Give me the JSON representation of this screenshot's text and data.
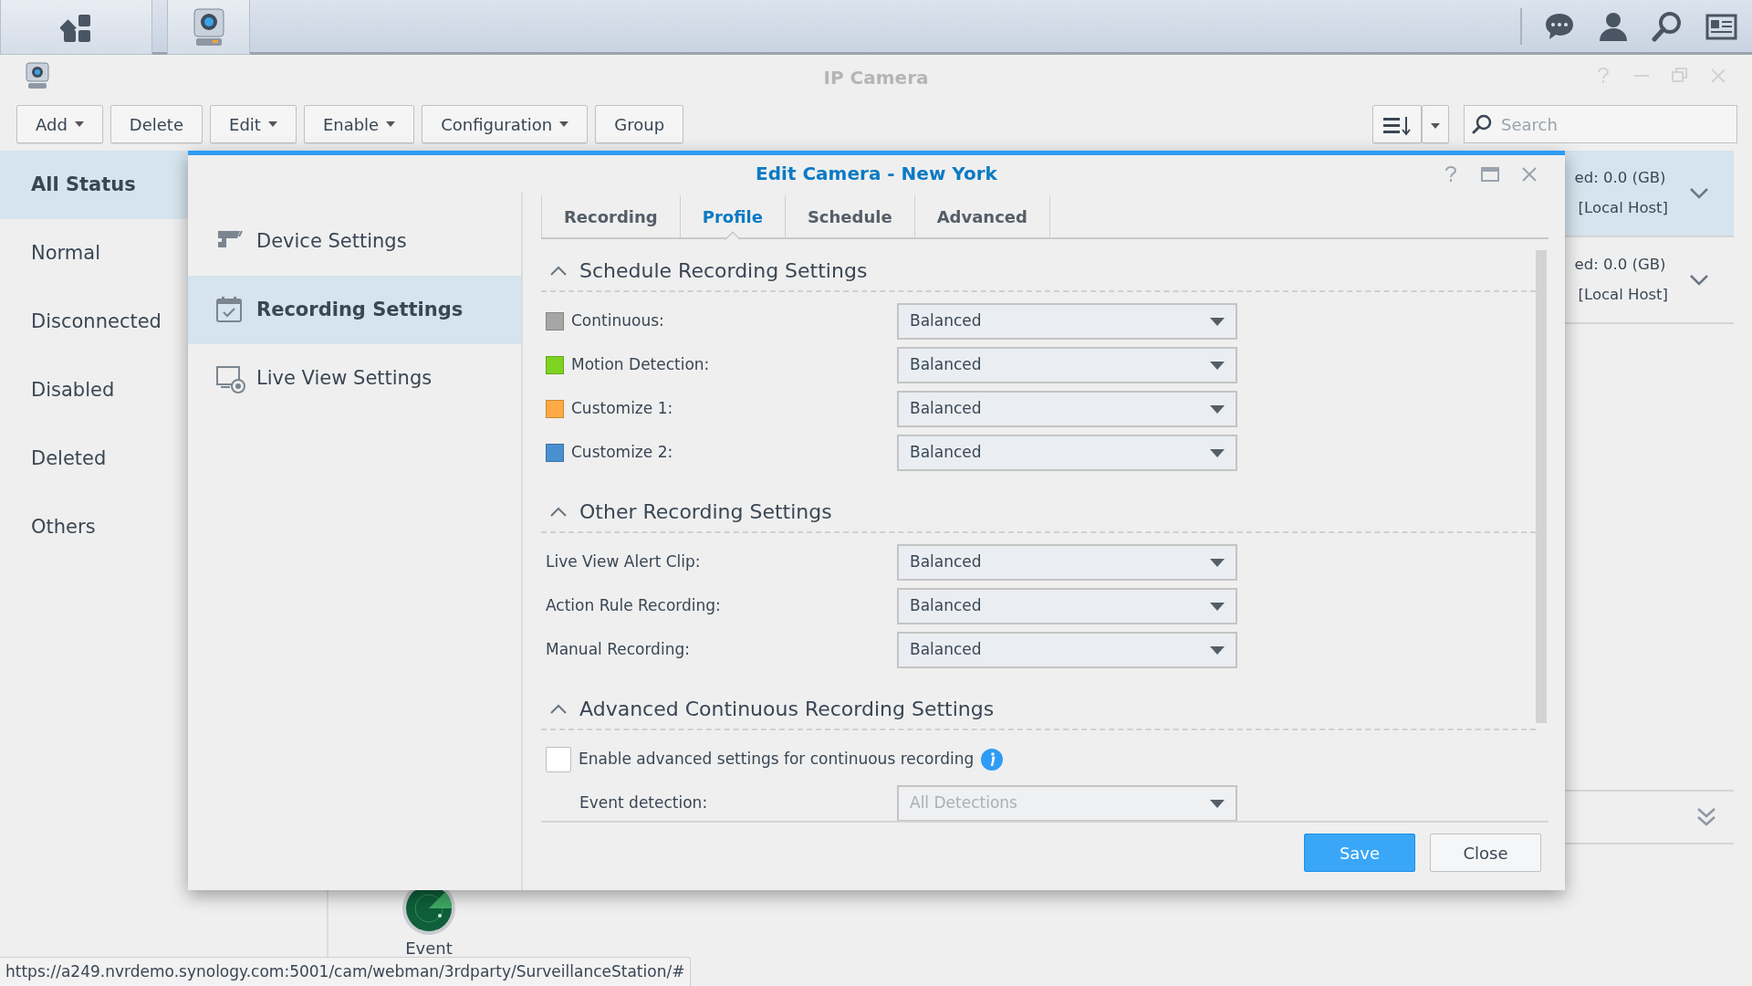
{
  "window": {
    "title": "IP Camera"
  },
  "toolbar": {
    "buttons": [
      {
        "label": "Add",
        "dropdown": true
      },
      {
        "label": "Delete",
        "dropdown": false
      },
      {
        "label": "Edit",
        "dropdown": true
      },
      {
        "label": "Enable",
        "dropdown": true
      },
      {
        "label": "Configuration",
        "dropdown": true
      },
      {
        "label": "Group",
        "dropdown": false
      }
    ],
    "search": {
      "placeholder": "Search"
    }
  },
  "sidebar": {
    "items": [
      {
        "label": "All Status",
        "selected": true
      },
      {
        "label": "Normal",
        "selected": false
      },
      {
        "label": "Disconnected",
        "selected": false
      },
      {
        "label": "Disabled",
        "selected": false
      },
      {
        "label": "Deleted",
        "selected": false
      },
      {
        "label": "Others",
        "selected": false
      }
    ]
  },
  "camera_list": {
    "rows": [
      {
        "storage": "ed: 0.0 (GB)",
        "host": "[Local Host]",
        "selected": true
      },
      {
        "storage": "ed: 0.0 (GB)",
        "host": "[Local Host]",
        "selected": false
      }
    ]
  },
  "app_icons": [
    {
      "label": "Event"
    }
  ],
  "dialog": {
    "title": "Edit Camera - New York",
    "nav": [
      {
        "label": "Device Settings",
        "kind": "device",
        "selected": false
      },
      {
        "label": "Recording Settings",
        "kind": "recording",
        "selected": true
      },
      {
        "label": "Live View Settings",
        "kind": "liveview",
        "selected": false
      }
    ],
    "tabs": [
      {
        "label": "Recording",
        "selected": false
      },
      {
        "label": "Profile",
        "selected": true
      },
      {
        "label": "Schedule",
        "selected": false
      },
      {
        "label": "Advanced",
        "selected": false
      }
    ],
    "sections": [
      {
        "title": "Schedule Recording Settings",
        "expanded": true,
        "rows": [
          {
            "kind": "select",
            "label": "Continuous:",
            "color": "#a6a6a6",
            "value": "Balanced",
            "disabled": false
          },
          {
            "kind": "select",
            "label": "Motion Detection:",
            "color": "#7ed321",
            "value": "Balanced",
            "disabled": false
          },
          {
            "kind": "select",
            "label": "Customize 1:",
            "color": "#ffaa44",
            "value": "Balanced",
            "disabled": false
          },
          {
            "kind": "select",
            "label": "Customize 2:",
            "color": "#4a90d0",
            "value": "Balanced",
            "disabled": false
          }
        ]
      },
      {
        "title": "Other Recording Settings",
        "expanded": true,
        "rows": [
          {
            "kind": "select",
            "label": "Live View Alert Clip:",
            "value": "Balanced",
            "disabled": false
          },
          {
            "kind": "select",
            "label": "Action Rule Recording:",
            "value": "Balanced",
            "disabled": false
          },
          {
            "kind": "select",
            "label": "Manual Recording:",
            "value": "Balanced",
            "disabled": false
          }
        ]
      },
      {
        "title": "Advanced Continuous Recording Settings",
        "expanded": true,
        "rows": [
          {
            "kind": "checkbox",
            "label": "Enable advanced settings for continuous recording",
            "checked": false,
            "info": true
          },
          {
            "kind": "subselect",
            "label": "Event detection:",
            "value": "All Detections",
            "disabled": true
          }
        ]
      }
    ],
    "buttons": [
      {
        "label": "Save",
        "primary": true
      },
      {
        "label": "Close",
        "primary": false
      }
    ]
  },
  "status_bar": "https://a249.nvrdemo.synology.com:5001/cam/webman/3rdparty/SurveillanceStation/#"
}
